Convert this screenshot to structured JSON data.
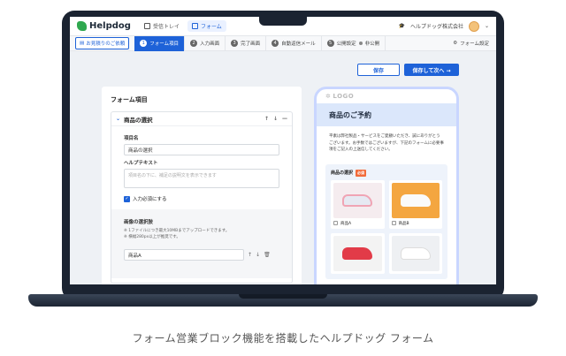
{
  "app": {
    "logo": "Helpdog"
  },
  "nav": {
    "tab1": "受信トレイ",
    "tab2": "フォーム",
    "company": "ヘルプドッグ株式会社"
  },
  "steps": {
    "back": "お見積りのご依頼",
    "items": [
      {
        "num": "1",
        "label": "フォーム項目"
      },
      {
        "num": "2",
        "label": "入力画面"
      },
      {
        "num": "3",
        "label": "完了画面"
      },
      {
        "num": "4",
        "label": "自動返信メール"
      },
      {
        "num": "5",
        "label": "公開設定"
      }
    ],
    "status": "非公開",
    "settings": "フォーム設定"
  },
  "actions": {
    "save": "保存",
    "save_next": "保存して次へ →"
  },
  "editor": {
    "title": "フォーム項目",
    "item_title": "商品の選択",
    "name_label": "項目名",
    "name_value": "商品の選択",
    "help_label": "ヘルプテキスト",
    "help_placeholder": "項目名の下に、補足の説明文を表示できます",
    "required_label": "入力必須にする",
    "image_label": "画像の選択肢",
    "note1": "※ 1ファイルにつき最大10MBまでアップロードできます。",
    "note2": "※ 横幅280px以上が推奨です。",
    "option1": "商品A"
  },
  "preview": {
    "logo": "LOGO",
    "title": "商品のご予約",
    "body": "平素は弊社製品・サービスをご愛顧いただき、誠にありがとうございます。お手数ではございますが、下記のフォームに必要事項をご記入の上送信してください。",
    "field": "商品の選択",
    "required": "必須",
    "products": [
      "商品A",
      "商品B"
    ]
  },
  "caption": "フォーム営業ブロック機能を搭載したヘルプドッグ フォーム",
  "colors": {
    "accent": "#1e62d8",
    "brand": "#2fa84f"
  }
}
